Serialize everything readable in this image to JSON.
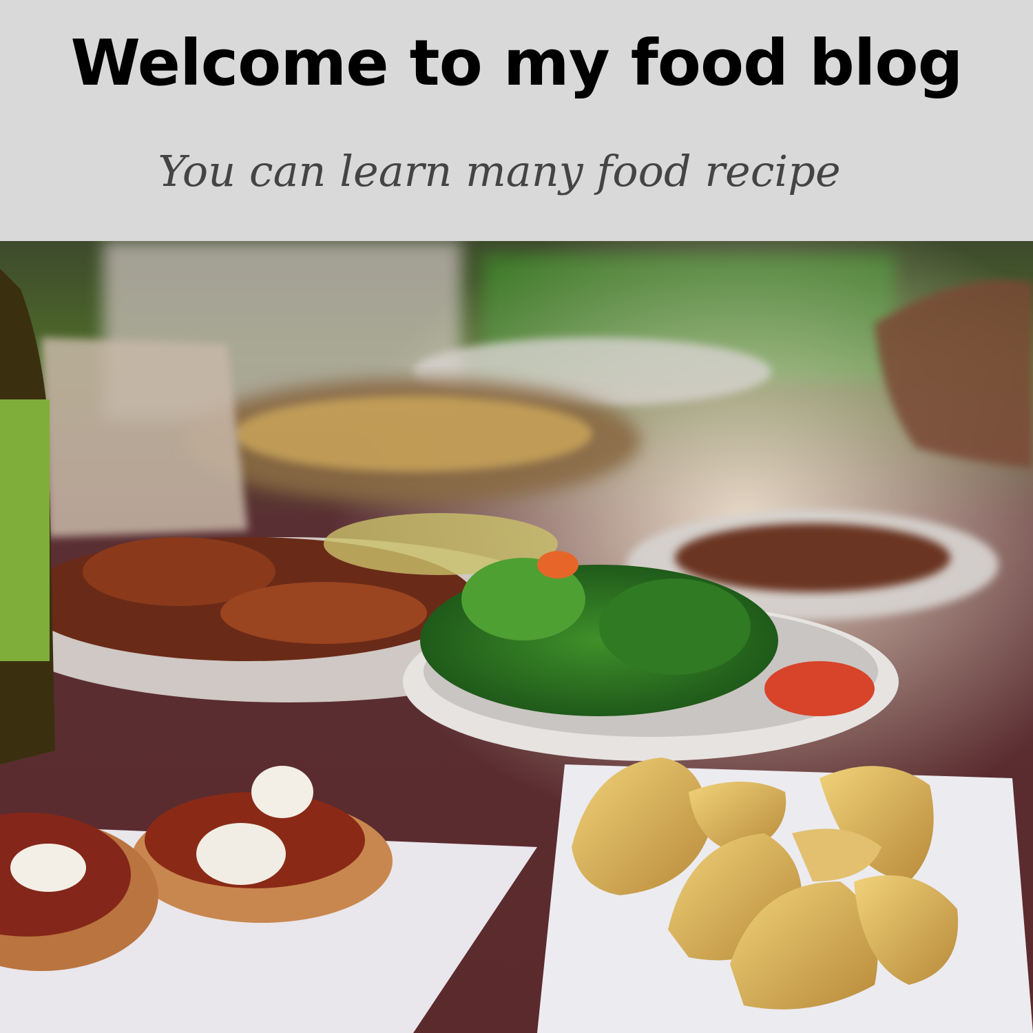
{
  "header": {
    "title": "Welcome to my food blog",
    "subtitle": "You can learn many food recipe"
  },
  "colors": {
    "header_bg": "#d9d9d9",
    "title": "#000000",
    "subtitle": "#444444"
  }
}
